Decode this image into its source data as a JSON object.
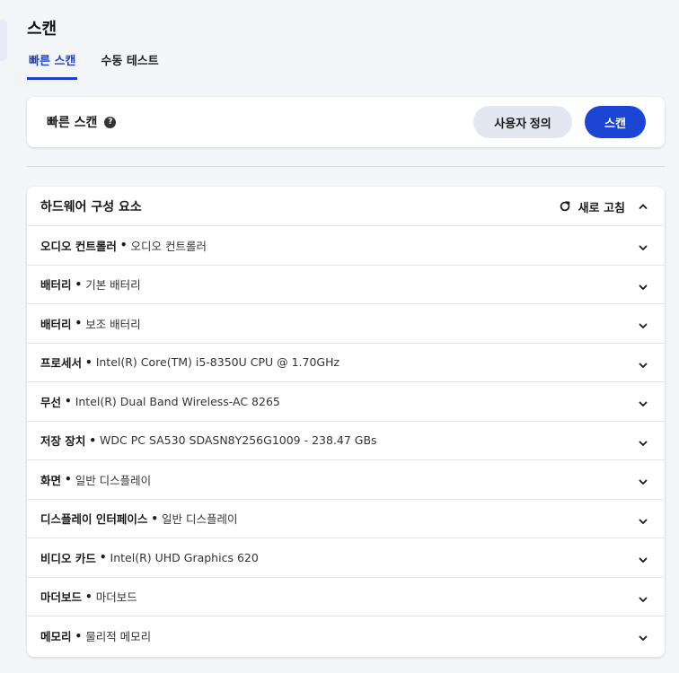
{
  "page": {
    "title": "스캔"
  },
  "tabs": [
    {
      "label": "빠른 스캔",
      "active": true
    },
    {
      "label": "수동 테스트",
      "active": false
    }
  ],
  "quick_scan": {
    "label": "빠른 스캔",
    "help_icon": "help-circle-icon",
    "custom_button": "사용자 정의",
    "scan_button": "스캔"
  },
  "hardware": {
    "title": "하드웨어 구성 요소",
    "refresh_label": "새로 고침",
    "items": [
      {
        "category": "오디오 컨트롤러",
        "value": "오디오 컨트롤러"
      },
      {
        "category": "배터리",
        "value": "기본 배터리"
      },
      {
        "category": "배터리",
        "value": "보조 배터리"
      },
      {
        "category": "프로세서",
        "value": "Intel(R) Core(TM) i5-8350U CPU @ 1.70GHz"
      },
      {
        "category": "무선",
        "value": "Intel(R) Dual Band Wireless-AC 8265"
      },
      {
        "category": "저장 장치",
        "value": "WDC PC SA530 SDASN8Y256G1009 - 238.47 GBs"
      },
      {
        "category": "화면",
        "value": "일반 디스플레이"
      },
      {
        "category": "디스플레이 인터페이스",
        "value": "일반 디스플레이"
      },
      {
        "category": "비디오 카드",
        "value": "Intel(R) UHD Graphics 620"
      },
      {
        "category": "마더보드",
        "value": "마더보드"
      },
      {
        "category": "메모리",
        "value": "물리적 메모리"
      }
    ],
    "separator": "•"
  },
  "colors": {
    "accent": "#1c45d6",
    "background": "#f4f5f8",
    "secondary_button": "#e3e7ef"
  }
}
